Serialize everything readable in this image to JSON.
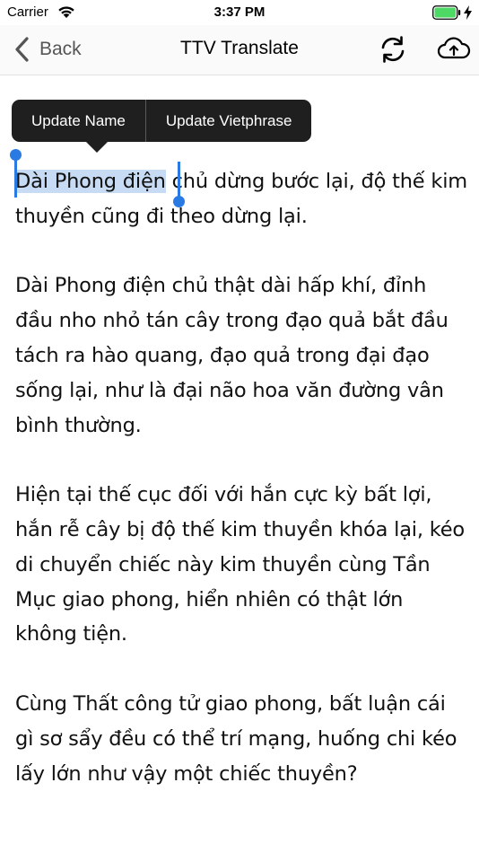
{
  "status_bar": {
    "carrier": "Carrier",
    "time": "3:37 PM",
    "icons": [
      "wifi-icon",
      "battery-icon",
      "charging-bolt-icon"
    ],
    "battery_color": "#4cd964"
  },
  "nav": {
    "back_label": "Back",
    "title": "TTV Translate",
    "icons": [
      "chevron-left-icon",
      "refresh-icon",
      "cloud-upload-icon"
    ]
  },
  "menu": {
    "update_name": "Update Name",
    "update_vietphrase": "Update Vietphrase"
  },
  "colors": {
    "selection": "#c7dcf4",
    "handle": "#2a7ae4",
    "menu_bg": "#1f1f1f"
  },
  "content": {
    "p1_selected": "Dài Phong điện",
    "p1_rest": " chủ dừng bước lại, độ thế kim thuyền cũng đi theo dừng lại.",
    "p2": "Dài Phong điện chủ thật dài hấp khí, đỉnh đầu nho nhỏ tán cây trong đạo quả bắt đầu tách ra hào quang, đạo quả trong đại đạo sống lại, như là đại não hoa văn đường vân bình thường.",
    "p3": "Hiện tại thế cục đối với hắn cực kỳ bất lợi, hắn rễ cây bị độ thế kim thuyền khóa lại, kéo di chuyển chiếc này kim thuyền cùng Tần Mục giao phong, hiển nhiên có thật lớn không tiện.",
    "p4": "Cùng Thất công tử giao phong, bất luận cái gì sơ sẩy đều có thể trí mạng, huống chi kéo lấy lớn như vậy một chiếc thuyền?"
  }
}
